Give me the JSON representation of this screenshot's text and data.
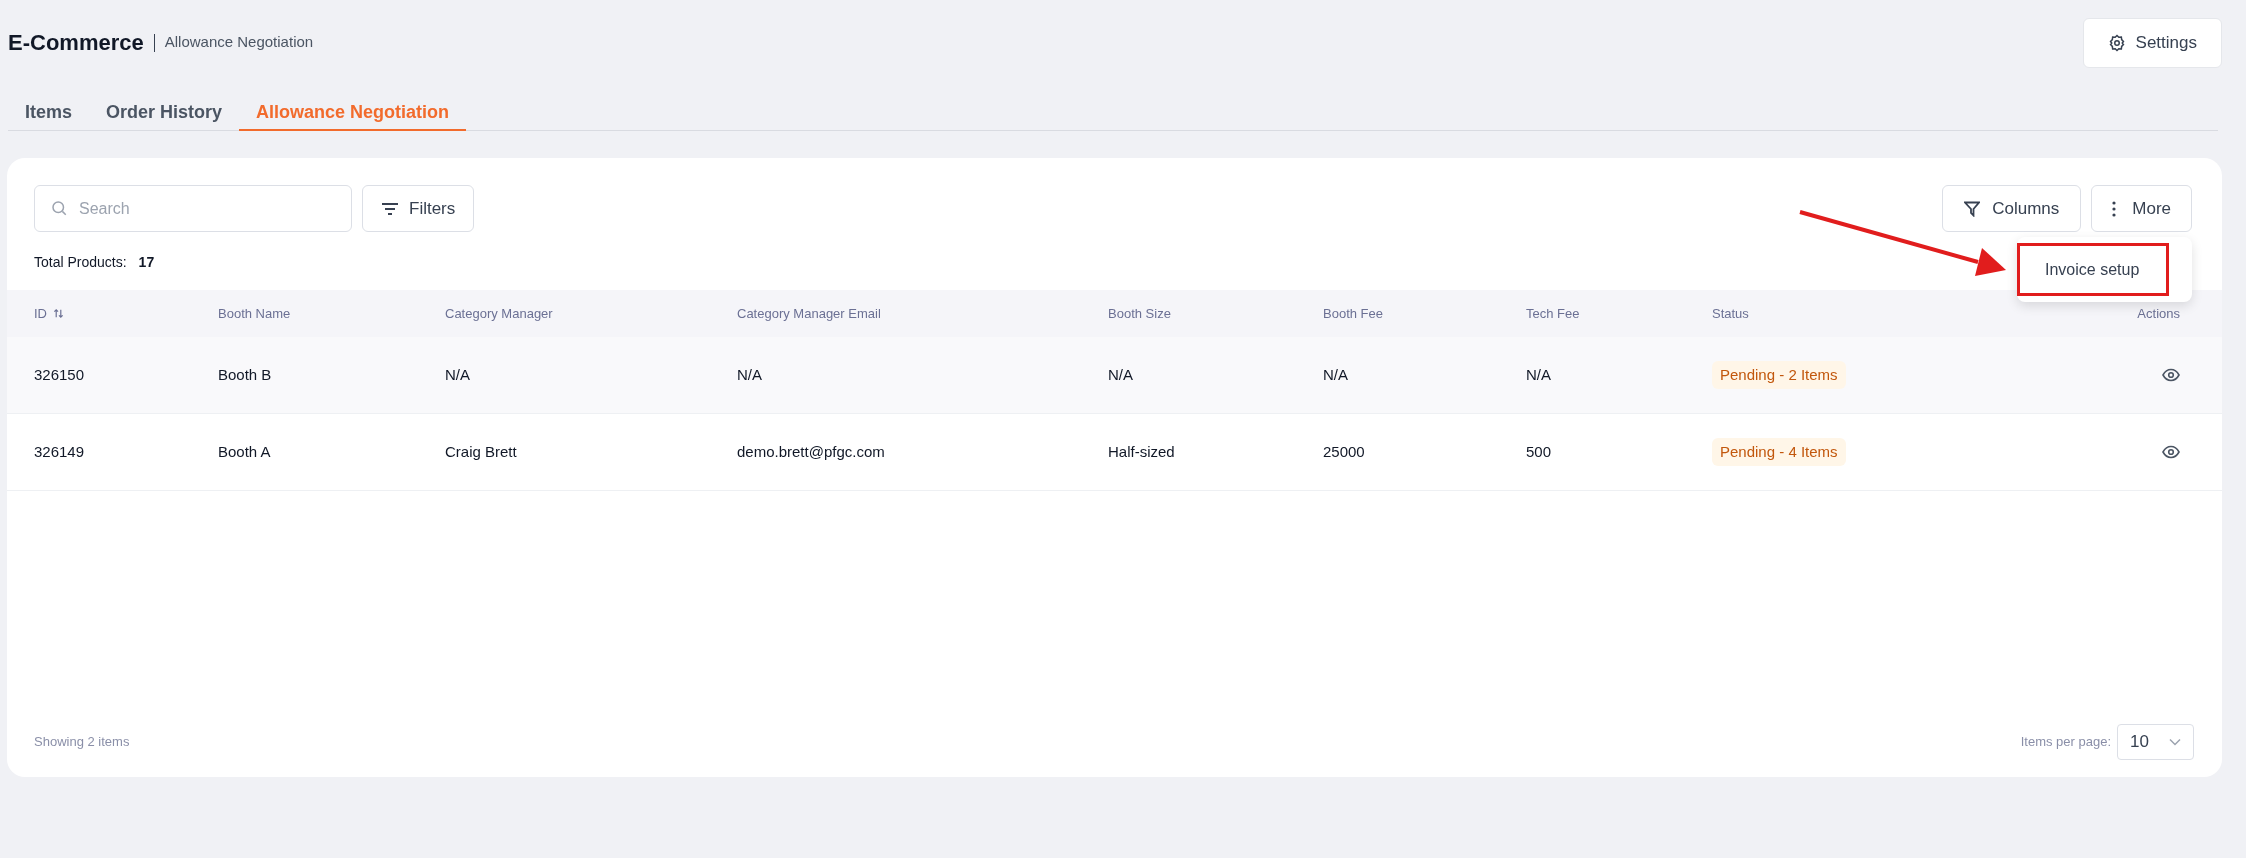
{
  "header": {
    "title": "E-Commerce",
    "subtitle": "Allowance Negotiation",
    "settings_button": "Settings"
  },
  "tabs": [
    {
      "label": "Items",
      "selected": false
    },
    {
      "label": "Order History",
      "selected": false
    },
    {
      "label": "Allowance Negotiation",
      "selected": true
    }
  ],
  "toolbar": {
    "search": {
      "placeholder": "Search"
    },
    "filters_button": "Filters",
    "columns_button": "Columns",
    "more_button": "More"
  },
  "more_menu": {
    "items": [
      {
        "label": "Invoice setup",
        "highlighted": true
      }
    ]
  },
  "total_products": {
    "label": "Total Products:",
    "value": "17"
  },
  "table": {
    "columns": [
      {
        "label": "ID",
        "sortable": true
      },
      {
        "label": "Booth Name",
        "sortable": false
      },
      {
        "label": "Category Manager",
        "sortable": false
      },
      {
        "label": "Category Manager Email",
        "sortable": false
      },
      {
        "label": "Booth Size",
        "sortable": false
      },
      {
        "label": "Booth Fee",
        "sortable": false
      },
      {
        "label": "Tech Fee",
        "sortable": false
      },
      {
        "label": "Status",
        "sortable": false
      },
      {
        "label": "Actions",
        "sortable": false
      }
    ],
    "rows": [
      {
        "cells": [
          "326150",
          "Booth B",
          "N/A",
          "N/A",
          "N/A",
          "N/A",
          "N/A"
        ],
        "status": "Pending - 2 Items"
      },
      {
        "cells": [
          "326149",
          "Booth A",
          "Craig Brett",
          "demo.brett@pfgc.com",
          "Half-sized",
          "25000",
          "500"
        ],
        "status": "Pending - 4 Items"
      }
    ]
  },
  "footer": {
    "showing": "Showing 2 items",
    "items_per_page_label": "Items per page:",
    "items_per_page": "10"
  }
}
